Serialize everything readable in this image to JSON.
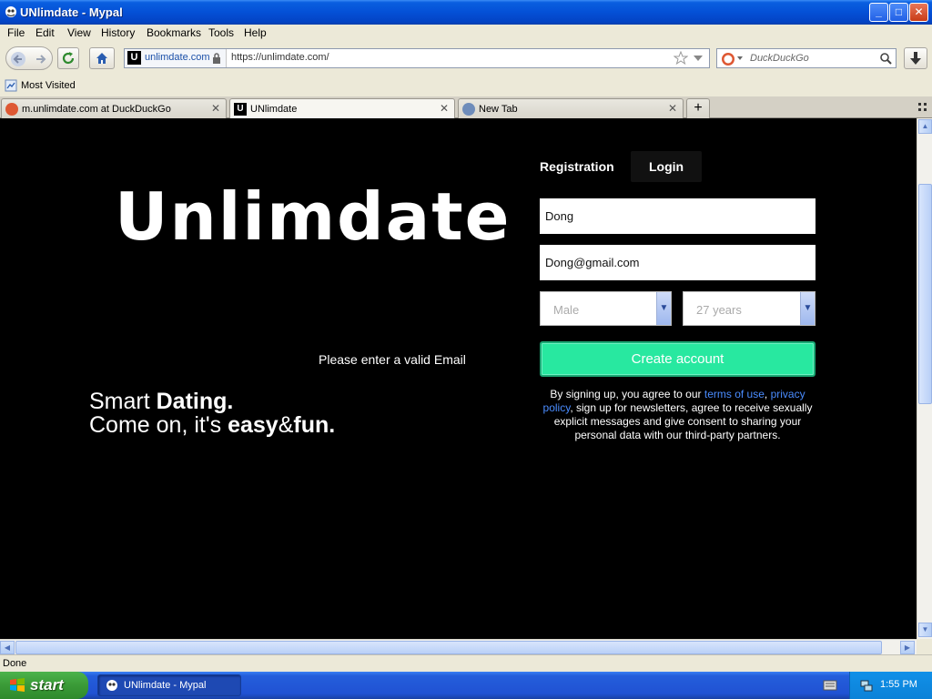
{
  "window": {
    "title": "UNlimdate - Mypal",
    "buttons": {
      "minimize": "_",
      "maximize": "□",
      "close": "✕"
    }
  },
  "menu": [
    "File",
    "Edit",
    "View",
    "History",
    "Bookmarks",
    "Tools",
    "Help"
  ],
  "nav": {
    "site_name": "unlimdate.com",
    "url": "https://unlimdate.com/",
    "search_placeholder": "DuckDuckGo"
  },
  "bookmarks": {
    "most_visited": "Most Visited"
  },
  "tabs": [
    {
      "label": "m.unlimdate.com at DuckDuckGo",
      "active": false
    },
    {
      "label": "UNlimdate",
      "active": true
    },
    {
      "label": "New Tab",
      "active": false
    }
  ],
  "page": {
    "logo": "Unlimdate",
    "valid_email_msg": "Please enter a valid Email",
    "slogan": {
      "line1_regular": "Smart ",
      "line1_bold": "Dating.",
      "line2_regular": "Come on, it's ",
      "line2_bold_a": "easy",
      "line2_amp": "&",
      "line2_bold_b": "fun."
    },
    "form": {
      "tab_registration": "Registration",
      "tab_login": "Login",
      "name_value": "Dong",
      "email_value": "Dong@gmail.com",
      "gender_value": "Male",
      "age_value": "27 years",
      "create_button": "Create account",
      "terms": {
        "part1": "By signing up, you agree to our ",
        "link1": "terms of use",
        "comma": ", ",
        "link2": "privacy policy",
        "part2": ", sign up for newsletters, agree to receive sexually explicit messages and give consent to sharing your personal data with our third-party partners."
      }
    }
  },
  "status": "Done",
  "taskbar": {
    "start": "start",
    "task_item": "UNlimdate - Mypal",
    "clock": "1:55 PM"
  },
  "colors": {
    "accent": "#28e8a0",
    "link": "#4a8cff",
    "page_bg": "#000000"
  }
}
